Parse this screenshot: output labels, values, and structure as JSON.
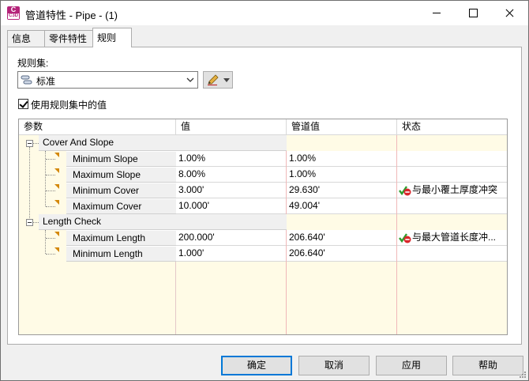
{
  "window": {
    "title": "管道特性 - Pipe - (1)",
    "app_icon": "C3D",
    "app_icon_sub": "C3D"
  },
  "tabs": [
    {
      "label": "信息",
      "active": false
    },
    {
      "label": "零件特性",
      "active": false
    },
    {
      "label": "规则",
      "active": true
    }
  ],
  "ruleset": {
    "label": "规则集:",
    "selected": "标准"
  },
  "use_ruleset_values": {
    "label": "使用规则集中的值",
    "checked": true
  },
  "grid": {
    "columns": [
      "参数",
      "值",
      "管道值",
      "状态"
    ],
    "groups": [
      {
        "name": "Cover And Slope",
        "rows": [
          {
            "param": "Minimum Slope",
            "value": "1.00%",
            "pipe_value": "1.00%",
            "status": ""
          },
          {
            "param": "Maximum Slope",
            "value": "8.00%",
            "pipe_value": "1.00%",
            "status": ""
          },
          {
            "param": "Minimum Cover",
            "value": "3.000'",
            "pipe_value": "29.630'",
            "status": "与最小覆土厚度冲突"
          },
          {
            "param": "Maximum Cover",
            "value": "10.000'",
            "pipe_value": "49.004'",
            "status": ""
          }
        ]
      },
      {
        "name": "Length Check",
        "rows": [
          {
            "param": "Maximum Length",
            "value": "200.000'",
            "pipe_value": "206.640'",
            "status": "与最大管道长度冲..."
          },
          {
            "param": "Minimum Length",
            "value": "1.000'",
            "pipe_value": "206.640'",
            "status": ""
          }
        ]
      }
    ]
  },
  "buttons": {
    "ok": "确定",
    "cancel": "取消",
    "apply": "应用",
    "help": "帮助"
  },
  "colors": {
    "grid_background": "#fffbe6",
    "status_ok_check": "#2e9e2e",
    "status_conflict": "#d9262b",
    "focus_border": "#0078d7"
  }
}
